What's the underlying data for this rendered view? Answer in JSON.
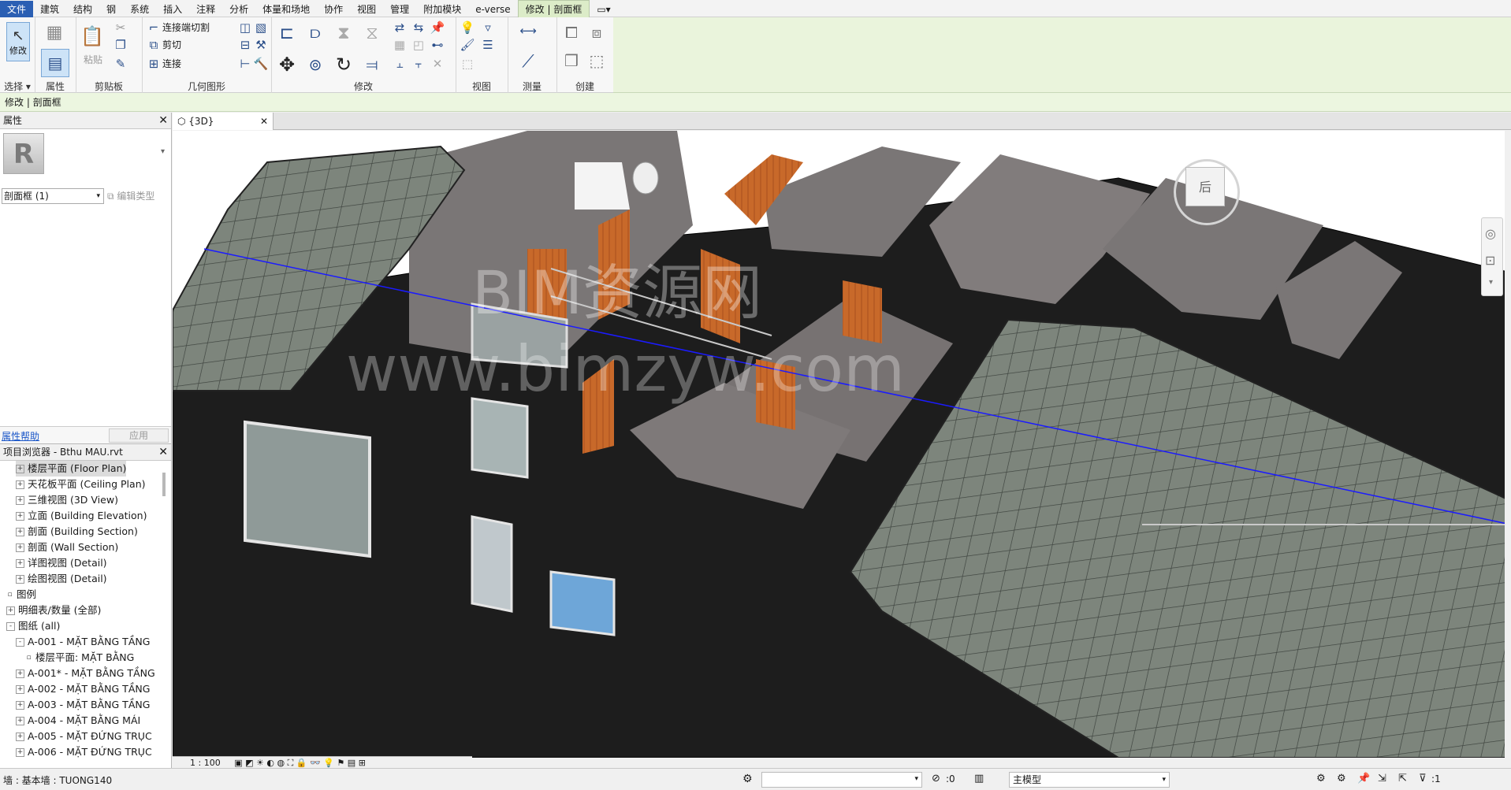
{
  "menu": {
    "tabs": [
      "文件",
      "建筑",
      "结构",
      "钢",
      "系统",
      "插入",
      "注释",
      "分析",
      "体量和场地",
      "协作",
      "视图",
      "管理",
      "附加模块",
      "e-verse",
      "修改 | 剖面框"
    ]
  },
  "ribbon": {
    "panels": {
      "select": "选择",
      "properties": "属性",
      "clipboard": "剪贴板",
      "geometry": "几何图形",
      "modify": "修改",
      "view": "视图",
      "measure": "测量",
      "create": "创建"
    },
    "modify_label": "修改",
    "paste_label": "粘贴",
    "geometry_items": [
      "连接端切割",
      "剪切",
      "连接"
    ]
  },
  "context_bar": "修改 | 剖面框",
  "properties": {
    "title": "属性",
    "type_selector": "剖面框 (1)",
    "edit_type": "编辑类型",
    "help_link": "属性帮助",
    "apply_button": "应用"
  },
  "browser": {
    "title": "项目浏览器 - Bthu MAU.rvt",
    "items": [
      {
        "label": "楼层平面 (Floor Plan)",
        "level": 1,
        "exp": "+"
      },
      {
        "label": "天花板平面 (Ceiling Plan)",
        "level": 1,
        "exp": "+"
      },
      {
        "label": "三维视图 (3D View)",
        "level": 1,
        "exp": "+"
      },
      {
        "label": "立面 (Building Elevation)",
        "level": 1,
        "exp": "+"
      },
      {
        "label": "剖面 (Building Section)",
        "level": 1,
        "exp": "+"
      },
      {
        "label": "剖面 (Wall Section)",
        "level": 1,
        "exp": "+"
      },
      {
        "label": "详图视图 (Detail)",
        "level": 1,
        "exp": "+"
      },
      {
        "label": "绘图视图 (Detail)",
        "level": 1,
        "exp": "+"
      },
      {
        "label": "图例",
        "level": 0,
        "exp": ""
      },
      {
        "label": "明细表/数量 (全部)",
        "level": 0,
        "exp": "+"
      },
      {
        "label": "图纸 (all)",
        "level": 0,
        "exp": "-"
      },
      {
        "label": "A-001 - MẶT BẰNG TẦNG",
        "level": 1,
        "exp": "-"
      },
      {
        "label": "楼层平面: MẶT BẰNG",
        "level": 2,
        "exp": ""
      },
      {
        "label": "A-001* - MẶT BẰNG TẦNG",
        "level": 1,
        "exp": "+"
      },
      {
        "label": "A-002 - MẶT BẰNG TẦNG",
        "level": 1,
        "exp": "+"
      },
      {
        "label": "A-003 - MẶT BẰNG TẦNG",
        "level": 1,
        "exp": "+"
      },
      {
        "label": "A-004 - MẶT BẰNG MÁI",
        "level": 1,
        "exp": "+"
      },
      {
        "label": "A-005 - MẶT ĐỨNG TRỤC",
        "level": 1,
        "exp": "+"
      },
      {
        "label": "A-006 - MẶT ĐỨNG TRỤC",
        "level": 1,
        "exp": "+"
      }
    ]
  },
  "view_tab": "{3D}",
  "view_scale": "1 : 100",
  "viewcube_face": "后",
  "watermark": {
    "line1": "BIM资源网",
    "line2": "www.bimzyw.com"
  },
  "status": {
    "left": "墙 : 基本墙 : TUONG140",
    "worksets": ":0",
    "model": "主模型",
    "filter": ":1"
  },
  "colors": {
    "file_tab": "#2b5fb3",
    "context": "#dcecc8",
    "wall": "#1b1b1b",
    "roof": "#7f877e",
    "wood": "#c8692a",
    "floor": "#7a7676"
  }
}
